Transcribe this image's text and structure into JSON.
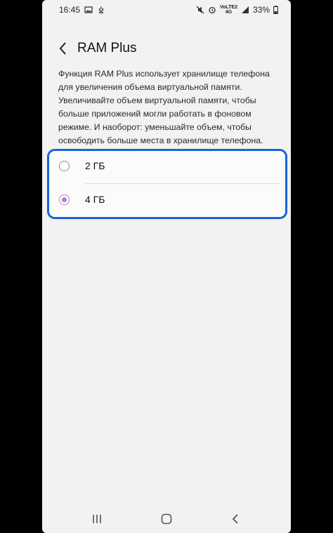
{
  "status_bar": {
    "time": "16:45",
    "network_top": "VoLTE2",
    "network_bottom": "4G",
    "battery": "33%"
  },
  "header": {
    "title": "RAM Plus"
  },
  "description": "Функция RAM Plus использует хранилище телефона для увеличения объема виртуальной памяти. Увеличивайте объем виртуальной памяти, чтобы больше приложений могли работать в фоновом режиме. И наоборот: уменьшайте объем, чтобы освободить больше места в хранилище телефона.",
  "options": [
    {
      "label": "2 ГБ",
      "selected": false
    },
    {
      "label": "4 ГБ",
      "selected": true
    }
  ],
  "colors": {
    "highlight_border": "#1565d8",
    "radio_selected": "#b17fc8",
    "background": "#f2f2f2"
  },
  "icons": {
    "status_left": [
      "gallery-icon",
      "notification-icon"
    ],
    "status_right": [
      "mute-icon",
      "alarm-icon",
      "signal-icon",
      "battery-icon"
    ],
    "nav": [
      "recents-icon",
      "home-icon",
      "back-icon"
    ]
  }
}
